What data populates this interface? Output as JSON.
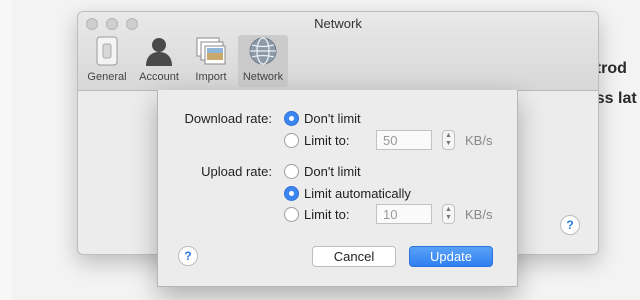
{
  "background": {
    "line1": "ntrod",
    "line2": "oss lat"
  },
  "window": {
    "title": "Network",
    "toolbar": [
      {
        "label": "General",
        "icon": "switch-icon"
      },
      {
        "label": "Account",
        "icon": "person-icon"
      },
      {
        "label": "Import",
        "icon": "photos-icon"
      },
      {
        "label": "Network",
        "icon": "globe-icon",
        "selected": true
      }
    ],
    "help": "?"
  },
  "sheet": {
    "download": {
      "label": "Download rate:",
      "option_no_limit": "Don't limit",
      "option_limit": "Limit to:",
      "selected": "no_limit",
      "value": "50",
      "unit": "KB/s"
    },
    "upload": {
      "label": "Upload rate:",
      "option_no_limit": "Don't limit",
      "option_auto": "Limit automatically",
      "option_limit": "Limit to:",
      "selected": "auto",
      "value": "10",
      "unit": "KB/s"
    },
    "buttons": {
      "cancel": "Cancel",
      "update": "Update"
    },
    "help": "?"
  },
  "colors": {
    "accent": "#3b86f2"
  }
}
